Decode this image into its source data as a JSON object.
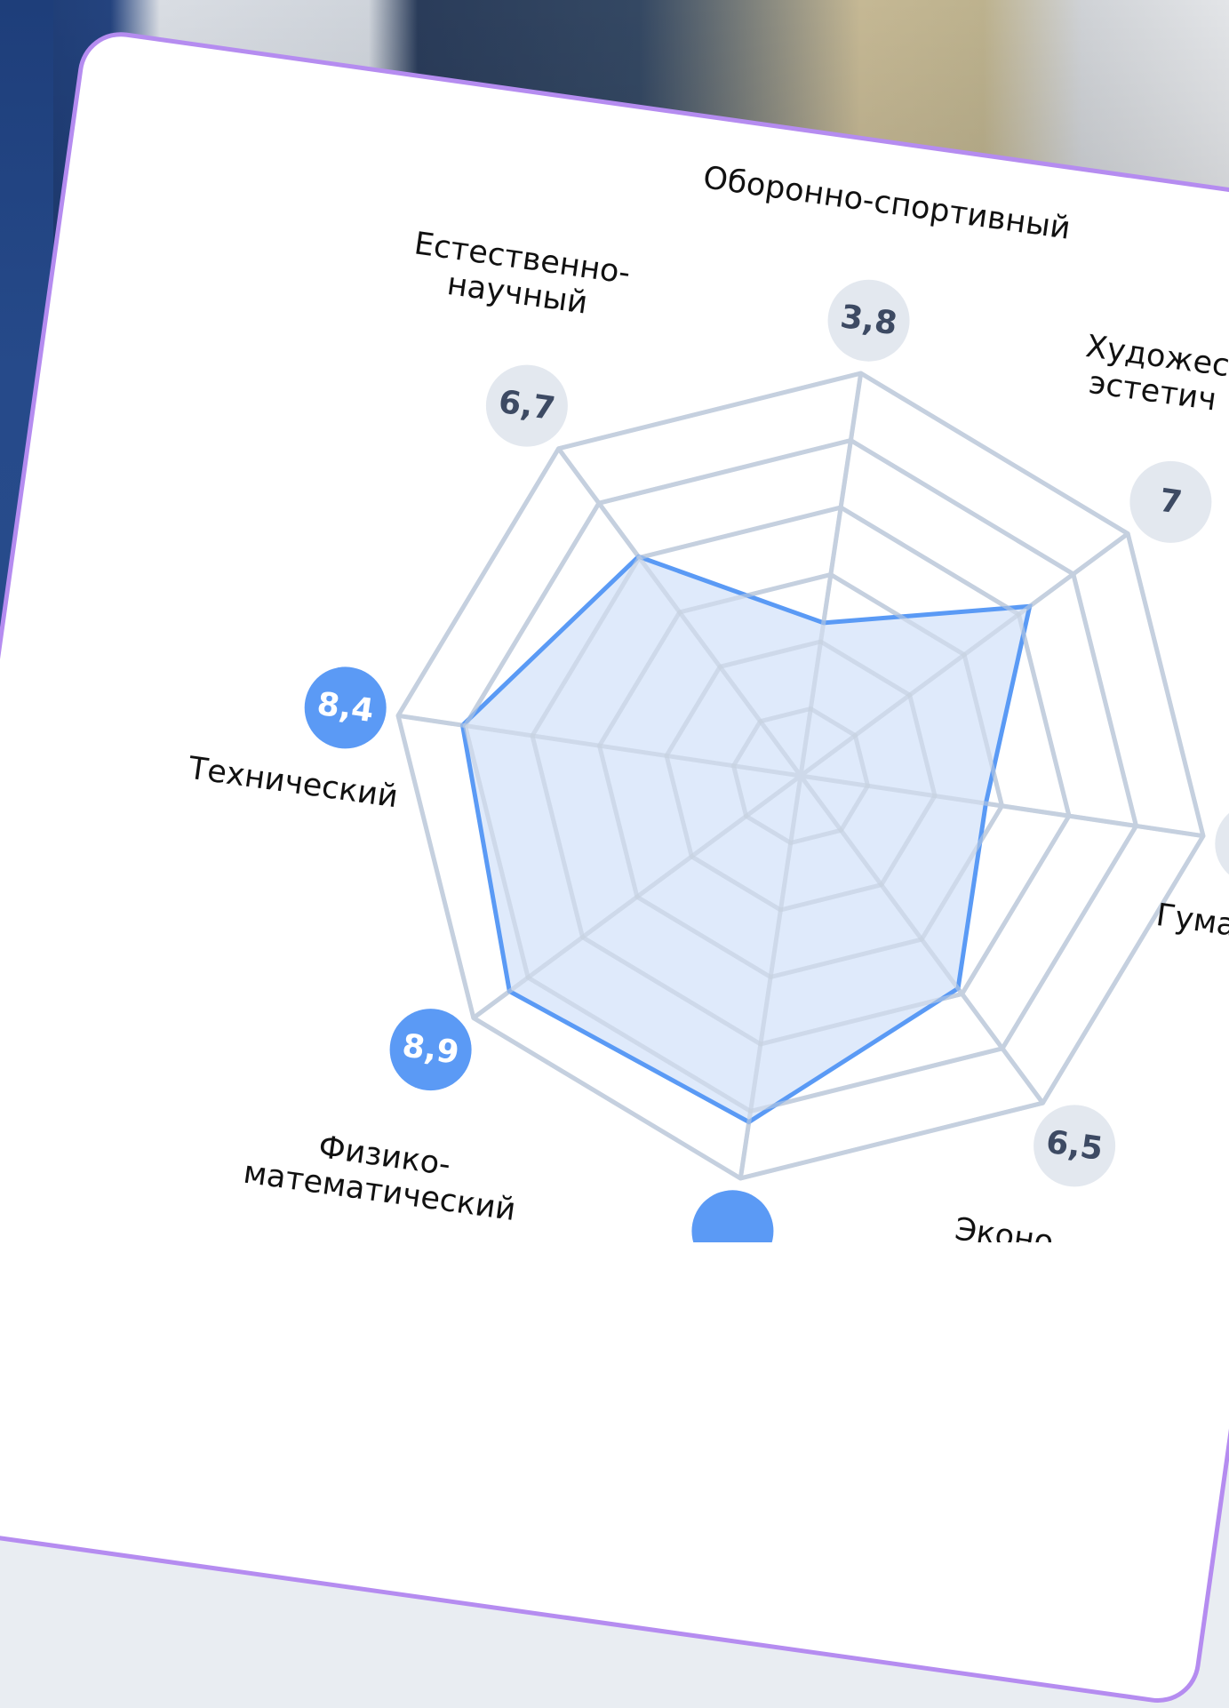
{
  "chart_data": {
    "type": "radar",
    "title": "",
    "scale_max": 10,
    "grid_levels": 6,
    "axes": [
      {
        "label_lines": [
          "Оборонно-спортивный"
        ],
        "value": 3.8,
        "value_label": "3,8",
        "highlight": false
      },
      {
        "label_lines": [
          "Художес",
          "эстетич"
        ],
        "value": 7,
        "value_label": "7",
        "highlight": false
      },
      {
        "label_lines": [
          "Гума"
        ],
        "value": 4.6,
        "value_label": "",
        "highlight": false
      },
      {
        "label_lines": [
          "Эконо"
        ],
        "value": 6.5,
        "value_label": "6,5",
        "highlight": false
      },
      {
        "label_lines": [
          ""
        ],
        "value": 8.6,
        "value_label": "",
        "highlight": true
      },
      {
        "label_lines": [
          "Физико-",
          "математический"
        ],
        "value": 8.9,
        "value_label": "8,9",
        "highlight": true
      },
      {
        "label_lines": [
          "Технический"
        ],
        "value": 8.4,
        "value_label": "8,4",
        "highlight": true
      },
      {
        "label_lines": [
          "Естественно-",
          "научный"
        ],
        "value": 6.7,
        "value_label": "6,7",
        "highlight": false
      }
    ],
    "colors": {
      "grid": "#c5d0df",
      "fill": "#dce8fb",
      "stroke": "#5a9af5",
      "highlight_badge": "#5b9af5",
      "normal_badge": "#e3e8ef",
      "normal_badge_text": "#3d4a63",
      "highlight_badge_text": "#ffffff"
    }
  }
}
